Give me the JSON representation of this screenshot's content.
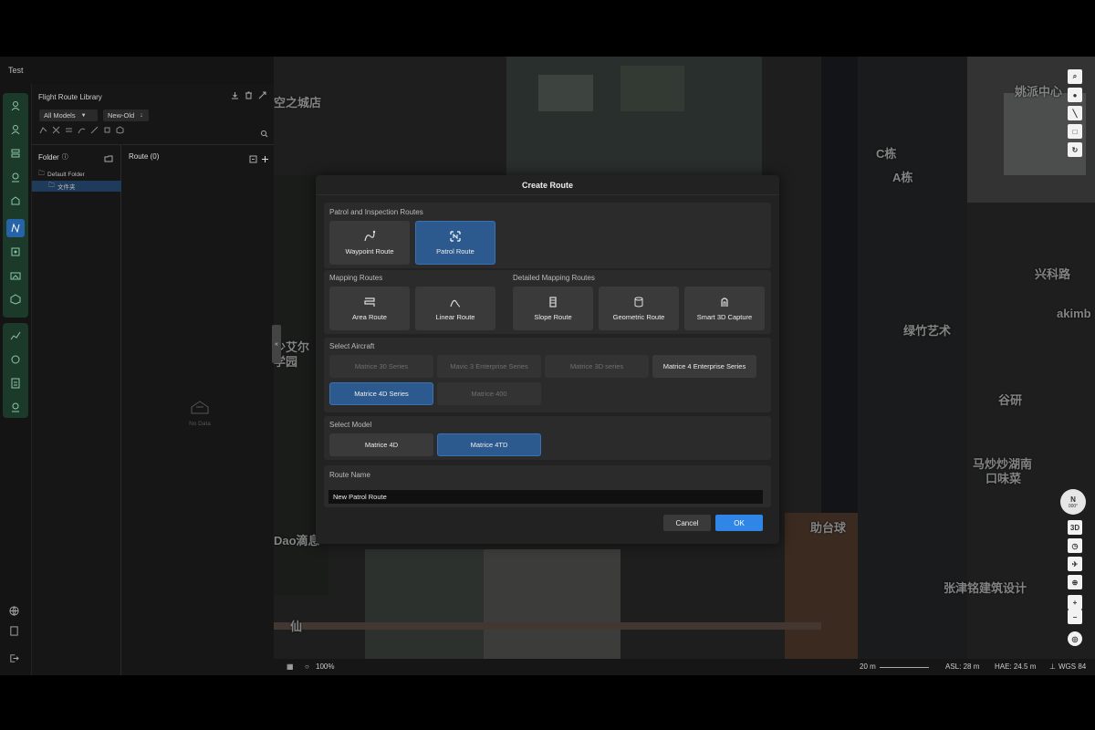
{
  "window": {
    "title": "Test"
  },
  "library": {
    "title": "Flight Route Library",
    "model_filter": "All Models",
    "sort_filter": "New-Old",
    "folder_header": "Folder",
    "route_header": "Route",
    "route_count": "(0)",
    "folders": [
      {
        "label": "Default Folder"
      },
      {
        "label": "文件夹"
      }
    ],
    "empty_text": "No Data"
  },
  "map": {
    "labels": [
      {
        "text": "空之城店"
      },
      {
        "text": "姚派中心"
      },
      {
        "text": "C栋"
      },
      {
        "text": "A栋"
      },
      {
        "text": "兴科路"
      },
      {
        "text": "绿竹艺术"
      },
      {
        "text": "akimb"
      },
      {
        "text": "谷研"
      },
      {
        "text": "马炒炒湖南"
      },
      {
        "text": "口味菜"
      },
      {
        "text": "助台球"
      },
      {
        "text": "张津铭建筑设计"
      },
      {
        "text": "少艾尔"
      },
      {
        "text": "学园"
      },
      {
        "text": "Dao滴息"
      },
      {
        "text": "仙"
      }
    ],
    "compass": "N",
    "compass_deg": "000°",
    "view_mode": "3D",
    "zoom_level": "100%",
    "scale": "20 m",
    "asl": "ASL: 28 m",
    "hae": "HAE: 24.5 m",
    "datum": "WGS 84"
  },
  "modal": {
    "title": "Create Route",
    "patrol_section": "Patrol and Inspection Routes",
    "patrol_routes": [
      {
        "label": "Waypoint Route",
        "icon": "waypoint-route-icon",
        "selected": false
      },
      {
        "label": "Patrol Route",
        "icon": "patrol-route-icon",
        "selected": true
      }
    ],
    "mapping_section": "Mapping Routes",
    "mapping_routes": [
      {
        "label": "Area Route",
        "icon": "area-route-icon"
      },
      {
        "label": "Linear Route",
        "icon": "linear-route-icon"
      }
    ],
    "detailed_section": "Detailed Mapping Routes",
    "detailed_routes": [
      {
        "label": "Slope Route",
        "icon": "slope-route-icon"
      },
      {
        "label": "Geometric Route",
        "icon": "geometric-route-icon"
      },
      {
        "label": "Smart 3D Capture",
        "icon": "smart-3d-capture-icon"
      }
    ],
    "aircraft_section": "Select Aircraft",
    "aircraft": [
      {
        "label": "Matrice 30 Series",
        "state": "disabled"
      },
      {
        "label": "Mavic 3 Enterprise Series",
        "state": "disabled"
      },
      {
        "label": "Matrice 3D series",
        "state": "disabled"
      },
      {
        "label": "Matrice 4 Enterprise Series",
        "state": "enabled"
      },
      {
        "label": "Matrice 4D Series",
        "state": "selected"
      },
      {
        "label": "Matrice 400",
        "state": "disabled"
      }
    ],
    "model_section": "Select Model",
    "models": [
      {
        "label": "Matrice 4D",
        "selected": false
      },
      {
        "label": "Matrice 4TD",
        "selected": true
      }
    ],
    "name_section": "Route Name",
    "route_name": "New Patrol Route",
    "cancel_label": "Cancel",
    "ok_label": "OK"
  },
  "colors": {
    "accent": "#2c5a8e",
    "ok_button": "#2f86e6",
    "rail_green": "#1b3a2a"
  }
}
